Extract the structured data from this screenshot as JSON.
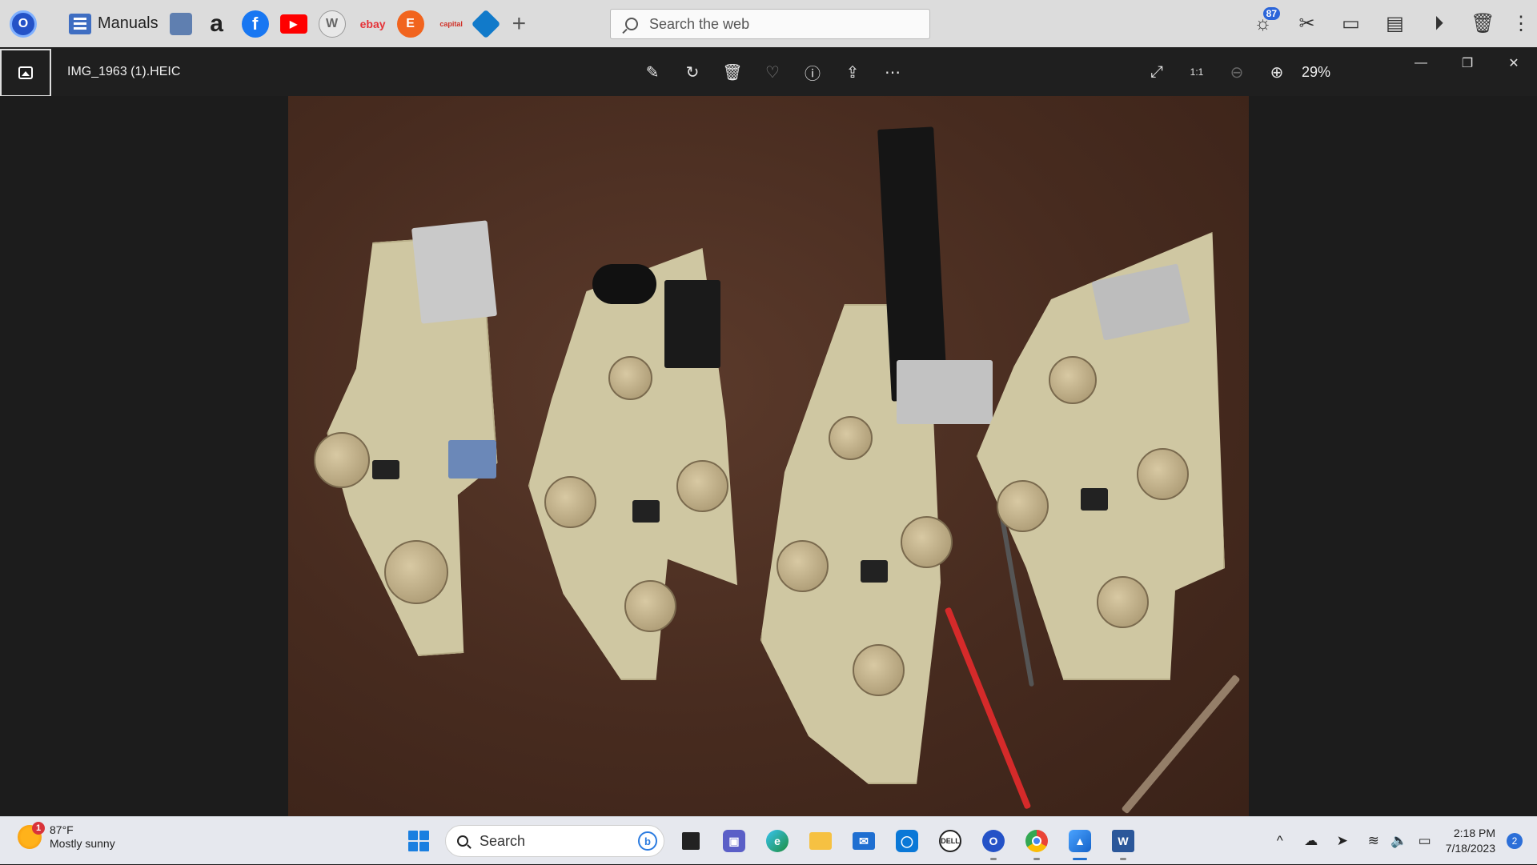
{
  "browser_bar": {
    "favorites": [
      {
        "name": "o-app-icon",
        "glyph": "O",
        "color": "#2452c7"
      },
      {
        "name": "manuals-bookmark",
        "label": "Manuals"
      },
      {
        "name": "notes-icon",
        "glyph": "",
        "color": "#5f7fb0"
      },
      {
        "name": "amazon-icon",
        "glyph": "a",
        "color": "#222222"
      },
      {
        "name": "facebook-icon",
        "glyph": "f",
        "color": "#1877f2"
      },
      {
        "name": "youtube-icon",
        "glyph": "▶",
        "color": "#ff0000"
      },
      {
        "name": "wikipedia-icon",
        "glyph": "W",
        "color": "#9a9a9a"
      },
      {
        "name": "ebay-icon",
        "glyph": "ebay",
        "color": "#e53238"
      },
      {
        "name": "etsy-icon",
        "glyph": "E",
        "color": "#f1641e"
      },
      {
        "name": "capitalone-icon",
        "glyph": "",
        "color": "#d03027"
      },
      {
        "name": "chase-icon",
        "glyph": "",
        "color": "#117aca"
      }
    ],
    "add_tab": "+",
    "search_placeholder": "Search the web",
    "right_badge": "87"
  },
  "viewer": {
    "filename": "IMG_1963 (1).HEIC",
    "zoom": "29%"
  },
  "taskbar": {
    "temperature": "87°F",
    "weather": "Mostly sunny",
    "weather_alert": "1",
    "search_label": "Search",
    "time": "2:18 PM",
    "date": "7/18/2023",
    "notifications": "2"
  }
}
